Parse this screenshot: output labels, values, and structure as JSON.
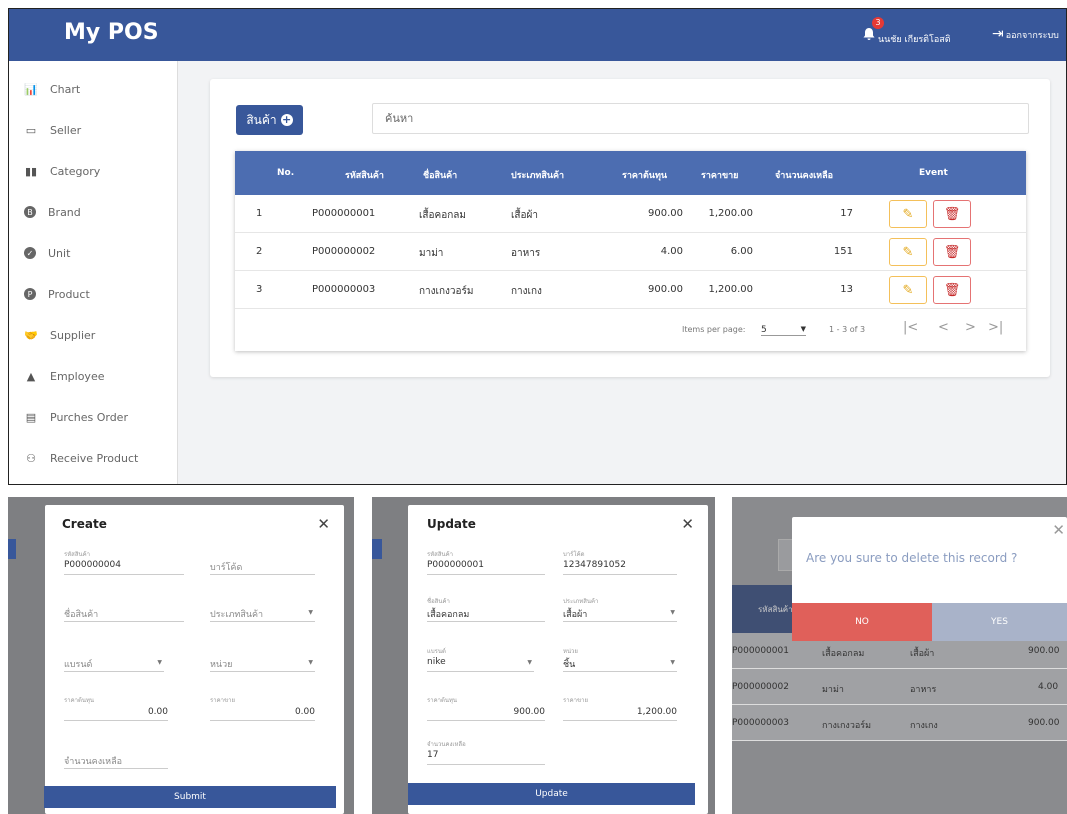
{
  "app": {
    "title": "My POS",
    "notif_count": "3",
    "user": "นนชัย เกียรติโอสติ",
    "logout": "ออกจากระบบ"
  },
  "sidebar": [
    {
      "label": "Chart",
      "icon": "chart-icon"
    },
    {
      "label": "Seller",
      "icon": "store-icon"
    },
    {
      "label": "Category",
      "icon": "book-icon"
    },
    {
      "label": "Brand",
      "icon": "brand-icon"
    },
    {
      "label": "Unit",
      "icon": "check-circle-icon"
    },
    {
      "label": "Product",
      "icon": "product-icon"
    },
    {
      "label": "Supplier",
      "icon": "handshake-icon"
    },
    {
      "label": "Employee",
      "icon": "employee-icon"
    },
    {
      "label": "Purches Order",
      "icon": "clipboard-icon"
    },
    {
      "label": "Receive Product",
      "icon": "people-icon"
    }
  ],
  "toolbar": {
    "add_label": "สินค้า",
    "search_placeholder": "ค้นหา"
  },
  "table": {
    "headers": [
      "No.",
      "รหัสสินค้า",
      "ชื่อสินค้า",
      "ประเภทสินค้า",
      "ราคาต้นทุน",
      "ราคาขาย",
      "จำนวนคงเหลือ",
      "Event"
    ],
    "rows": [
      [
        "1",
        "P000000001",
        "เสื้อคอกลม",
        "เสื้อผ้า",
        "900.00",
        "1,200.00",
        "17"
      ],
      [
        "2",
        "P000000002",
        "มาม่า",
        "อาหาร",
        "4.00",
        "6.00",
        "151"
      ],
      [
        "3",
        "P000000003",
        "กางเกงวอร์ม",
        "กางเกง",
        "900.00",
        "1,200.00",
        "13"
      ]
    ],
    "items_per_page_label": "Items per page:",
    "items_per_page": "5",
    "range": "1 - 3 of 3"
  },
  "create_modal": {
    "title": "Create",
    "code_label": "รหัสสินค้า",
    "code_value": "P000000004",
    "barcode_ph": "บาร์โค้ด",
    "name_ph": "ชื่อสินค้า",
    "category_ph": "ประเภทสินค้า",
    "brand_ph": "แบรนด์",
    "unit_ph": "หน่วย",
    "cost_label": "ราคาต้นทุน",
    "cost_value": "0.00",
    "price_label": "ราคาขาย",
    "price_value": "0.00",
    "stock_ph": "จำนวนคงเหลือ",
    "submit": "Submit"
  },
  "update_modal": {
    "title": "Update",
    "code_label": "รหัสสินค้า",
    "code_value": "P000000001",
    "barcode_label": "บาร์โค้ด",
    "barcode_value": "12347891052",
    "name_label": "ชื่อสินค้า",
    "name_value": "เสื้อคอกลม",
    "category_label": "ประเภทสินค้า",
    "category_value": "เสื้อผ้า",
    "brand_label": "แบรนด์",
    "brand_value": "nike",
    "unit_label": "หน่วย",
    "unit_value": "ชิ้น",
    "cost_label": "ราคาต้นทุน",
    "cost_value": "900.00",
    "price_label": "ราคาขาย",
    "price_value": "1,200.00",
    "stock_label": "จำนวนคงเหลือ",
    "stock_value": "17",
    "submit": "Update"
  },
  "delete_modal": {
    "message": "Are you sure to delete this record ?",
    "no": "NO",
    "yes": "YES",
    "bg_header": "รหัสสินค้า",
    "bg_rows": [
      [
        "P000000001",
        "เสื้อคอกลม",
        "เสื้อผ้า",
        "900.00"
      ],
      [
        "P000000002",
        "มาม่า",
        "อาหาร",
        "4.00"
      ],
      [
        "P000000003",
        "กางเกงวอร์ม",
        "กางเกง",
        "900.00"
      ]
    ]
  },
  "colors": {
    "primary": "#38579a",
    "table_header": "#4c6db1",
    "edit": "#e3a81c",
    "delete": "#c62828",
    "no_btn": "#e0605a",
    "yes_btn": "#a9b3c9"
  }
}
